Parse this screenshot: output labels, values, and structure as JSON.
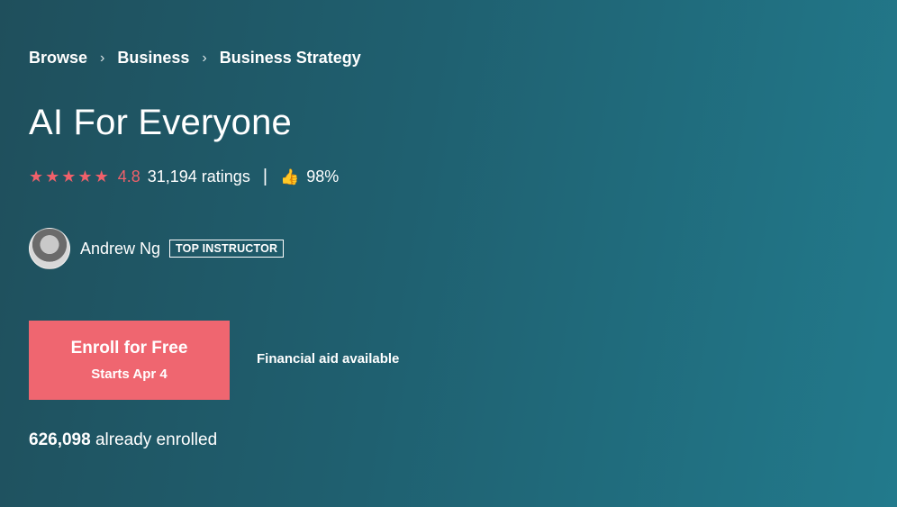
{
  "breadcrumb": {
    "items": [
      "Browse",
      "Business",
      "Business Strategy"
    ],
    "separator": "›"
  },
  "course": {
    "title": "AI For Everyone",
    "rating": {
      "stars_icon": "★",
      "value": "4.8",
      "count_text": "31,194 ratings",
      "divider": "|",
      "thumbs_icon": "👍",
      "approval": "98%"
    }
  },
  "instructor": {
    "name": "Andrew Ng",
    "badge": "TOP INSTRUCTOR"
  },
  "enroll": {
    "label": "Enroll for Free",
    "sub_label": "Starts Apr 4",
    "financial_aid": "Financial aid available"
  },
  "enrollment": {
    "count": "626,098",
    "suffix": " already enrolled"
  },
  "colors": {
    "accent": "#ef6670",
    "background_start": "#1f4f5c",
    "background_end": "#227a8c"
  }
}
